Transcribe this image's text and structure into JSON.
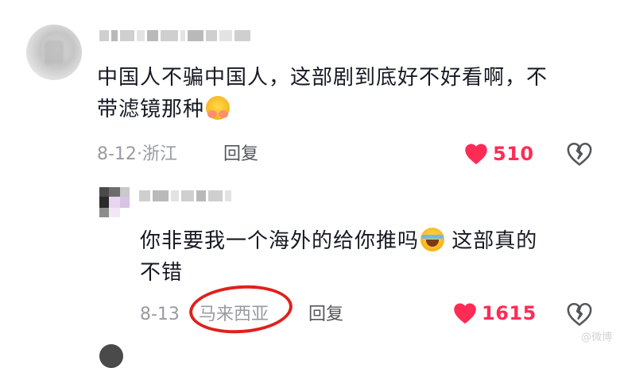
{
  "comment1": {
    "text": "中国人不骗中国人，这部剧到底好不好看啊，不带滤镜那种",
    "line1": "中国人不骗中国人，这部剧到底好不好看啊，不",
    "line2": "带滤镜那种",
    "emoji_icon": "hugging-face-emoji-icon",
    "date": "8-12",
    "separator": "·",
    "location": "浙江",
    "reply_label": "回复",
    "likes": "510"
  },
  "reply1": {
    "line1_a": "你非要我一个海外的给你推吗",
    "emoji_icon": "rolling-laughing-emoji-icon",
    "line1_b": "这部真的",
    "line2": "不错",
    "date": "8-13",
    "location": "马来西亚",
    "reply_label": "回复",
    "likes": "1615"
  },
  "colors": {
    "like": "#fe2c55",
    "text": "#161823",
    "meta": "#9a9ba1",
    "annotation_ring": "#e0201c"
  },
  "icons": [
    "heart-icon",
    "broken-heart-icon"
  ],
  "watermark": "@微博"
}
